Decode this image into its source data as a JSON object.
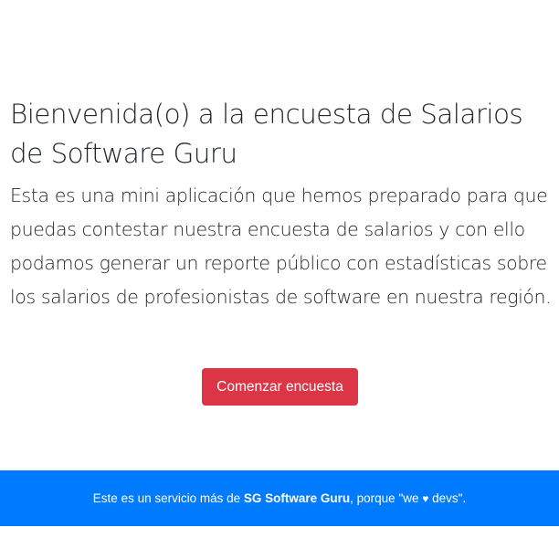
{
  "hero": {
    "title": "Bienvenida(o) a la encuesta de Salarios de Software Guru",
    "lead": "Esta es una mini aplicación que hemos preparado para que puedas contestar nuestra encuesta de salarios y con ello podamos generar un reporte público con estadísticas sobre los salarios de profesionistas de software en nuestra región."
  },
  "cta": {
    "label": "Comenzar encuesta"
  },
  "footer": {
    "prefix": "Este es un servicio más de ",
    "brand": "SG Software Guru",
    "middle": ", porque \"we ",
    "heart": "♥",
    "suffix": " devs\"."
  },
  "colors": {
    "cta_background": "#dc3545",
    "footer_background": "#007bff",
    "text": "#212529"
  }
}
